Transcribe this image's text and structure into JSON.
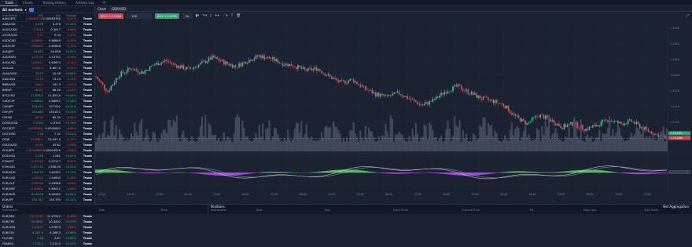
{
  "tabs": [
    "Trade",
    "Charts",
    "Trading History",
    "Activity Log"
  ],
  "tab_plus": "+",
  "watchlist": {
    "selector": "All markets",
    "columns": [
      "Instrument",
      "Bid",
      "Ask",
      "Change",
      ""
    ],
    "rows": [
      {
        "sym": "AAVE/BTC",
        "bid": "0.00083730",
        "ask": "0.00083760",
        "chg": "-0.37%",
        "dir": "dn"
      },
      {
        "sym": "ADA/USD",
        "bid": "0.476",
        "ask": "0.476",
        "chg": "+1.25%",
        "dir": "up"
      },
      {
        "sym": "ALGO/USD",
        "bid": "0.3016",
        "ask": "0.3017",
        "chg": "-0.96%",
        "dir": "dn"
      },
      {
        "sym": "ATOM/USD",
        "bid": "9.31",
        "ask": "9.33",
        "chg": "-1.57%",
        "dir": "dn"
      },
      {
        "sym": "AUD/CAD",
        "bid": "0.88645",
        "ask": "0.88649",
        "chg": "-0.29%",
        "dir": "dn"
      },
      {
        "sym": "AUD/CHF",
        "bid": "0.60852",
        "ask": "0.60858",
        "chg": "-0.12%",
        "dir": "dn"
      },
      {
        "sym": "AUD/JPY",
        "bid": "94.852",
        "ask": "94.858",
        "chg": "+0.02%",
        "dir": "up"
      },
      {
        "sym": "AUD/NZD",
        "bid": "1.10746",
        "ask": "1.10751",
        "chg": "-0.08%",
        "dir": "dn"
      },
      {
        "sym": "AUD/USD",
        "bid": "0.65671",
        "ask": "0.65674",
        "chg": "-0.11%",
        "dir": "dn"
      },
      {
        "sym": "AUS200",
        "bid": "6,855.0",
        "ask": "6,857.0",
        "chg": "-0.31%",
        "dir": "dn"
      },
      {
        "sym": "AVAX/USD",
        "bid": "20.37",
        "ask": "20.38",
        "chg": "+0.64%",
        "dir": "up"
      },
      {
        "sym": "AXS/USD",
        "bid": "13.12",
        "ask": "13.14",
        "chg": "-2.11%",
        "dir": "dn"
      },
      {
        "sym": "BNB/USD",
        "bid": "240.3",
        "ask": "241.3",
        "chg": "-0.37%",
        "dir": "dn"
      },
      {
        "sym": "BRENT",
        "bid": "86.47",
        "ask": "86.50",
        "chg": "-0.21%",
        "dir": "dn"
      },
      {
        "sym": "BTC/USD",
        "bid": "21,828.0",
        "ask": "21,853.0",
        "chg": "+0.44%",
        "dir": "up"
      },
      {
        "sym": "CAD/CHF",
        "bid": "0.68642",
        "ask": "0.68651",
        "chg": "+0.18%",
        "dir": "up"
      },
      {
        "sym": "CAD/JPY",
        "bid": "106.991",
        "ask": "107.001",
        "chg": "+0.31%",
        "dir": "up"
      },
      {
        "sym": "CHF/JPY",
        "bid": "155.863",
        "ask": "155.871",
        "chg": "+0.15%",
        "dir": "up"
      },
      {
        "sym": "CRUDE",
        "bid": "80.32",
        "ask": "80.35",
        "chg": "-0.48%",
        "dir": "dn"
      },
      {
        "sym": "DOGE/USD",
        "bid": "0.0794",
        "ask": "0.0795",
        "chg": "+0.78%",
        "dir": "up"
      },
      {
        "sym": "DOT/BTC",
        "bid": "0.0002682",
        "ask": "0.0002697",
        "chg": "-0.68%",
        "dir": "dn"
      },
      {
        "sym": "DOT/USD",
        "bid": "7.28",
        "ask": "7.31",
        "chg": "+0.21%",
        "dir": "up"
      },
      {
        "sym": "DOW",
        "bid": "33,988.0",
        "ask": "33,991.0",
        "chg": "-0.12%",
        "dir": "dn"
      },
      {
        "sym": "EGLD/USD",
        "bid": "45.48",
        "ask": "45.62",
        "chg": "-1.43%",
        "dir": "dn"
      },
      {
        "sym": "EOS/BTC",
        "bid": "0.00004880",
        "ask": "0.00004910",
        "chg": "-0.99%",
        "dir": "dn"
      },
      {
        "sym": "EOS/USD",
        "bid": "1.056",
        "ask": "1.061",
        "chg": "+0.47%",
        "dir": "up"
      },
      {
        "sym": "ETH/BTC",
        "bid": "0.07124",
        "ask": "0.07127",
        "chg": "-0.22%",
        "dir": "dn"
      },
      {
        "sym": "ETH/USD",
        "bid": "1,557.42",
        "ask": "1,558.09",
        "chg": "+0.21%",
        "dir": "up"
      },
      {
        "sym": "EUR/AUD",
        "bid": "1.64275",
        "ask": "1.64287",
        "chg": "+0.13%",
        "dir": "up"
      },
      {
        "sym": "EUR/CAD",
        "bid": "1.45624",
        "ask": "1.45635",
        "chg": "-0.16%",
        "dir": "dn"
      },
      {
        "sym": "EUR/CHF",
        "bid": "0.99958",
        "ask": "0.99966",
        "chg": "-0.03%",
        "dir": "dn"
      },
      {
        "sym": "EUR/GBP",
        "bid": "0.89005",
        "ask": "0.89011",
        "chg": "-0.08%",
        "dir": "dn"
      },
      {
        "sym": "EUR/HKD",
        "bid": "8.45208",
        "ask": "8.45289",
        "chg": "+0.02%",
        "dir": "up"
      },
      {
        "sym": "EUR/JPY",
        "bid": "155.787",
        "ask": "155.795",
        "chg": "+0.12%",
        "dir": "up"
      },
      {
        "sym": "EUR/MXN",
        "bid": "20.77717",
        "ask": "20.79351",
        "chg": "+0.31%",
        "dir": "up"
      },
      {
        "sym": "EUR/NZD",
        "bid": "1.81922",
        "ask": "1.81951",
        "chg": "+0.05%",
        "dir": "up"
      },
      {
        "sym": "EUR/SEK",
        "bid": "11.27431",
        "ask": "11.27911",
        "chg": "-0.18%",
        "dir": "dn"
      },
      {
        "sym": "EUR/TRY",
        "bid": "20.3051",
        "ask": "20.3401",
        "chg": "+0.07%",
        "dir": "up"
      },
      {
        "sym": "EUR/USD",
        "bid": "1.07875",
        "ask": "1.07879",
        "chg": "-0.04%",
        "dir": "dn"
      },
      {
        "sym": "EURO50",
        "bid": "4,267.0",
        "ask": "4,268.5",
        "chg": "+0.46%",
        "dir": "up"
      },
      {
        "sym": "FIL/USD",
        "bid": "5.66",
        "ask": "5.67",
        "chg": "+1.85%",
        "dir": "up"
      },
      {
        "sym": "FRANCE",
        "bid": "7,213.5",
        "ask": "7,214.5",
        "chg": "+0.37%",
        "dir": "up"
      }
    ],
    "trade_label": "Trade"
  },
  "chart": {
    "window_label": "Chart",
    "instrument": "GBP/USD",
    "sell_label": "SELL",
    "sell_price": "1.21248",
    "buy_label": "BUY",
    "buy_price": "1.21259",
    "quantity": "100",
    "timeframe": "1h",
    "price_ticks": [
      "1.2400",
      "1.2350",
      "1.2300",
      "1.2250",
      "1.2200",
      "1.2150",
      "1.2100",
      "1.2050"
    ],
    "price_tag_buy": "1.21259",
    "price_tag_sell": "1.21248",
    "time_ticks": [
      "07:00",
      "14:00",
      "21:00",
      "04:00",
      "11:00",
      "18:00",
      "01:00",
      "08:00",
      "15:00",
      "22:00",
      "05:00",
      "12:00",
      "19:00",
      "02:00",
      "09:00",
      "16:00",
      "23:00",
      "06:00",
      "13:00",
      "20:00"
    ]
  },
  "chart_data": {
    "type": "candlestick",
    "series": [
      {
        "values": [
          1.2268,
          1.2232,
          1.2275,
          1.229,
          1.228,
          1.23,
          1.231,
          1.2296,
          1.2288,
          1.2302,
          1.2318,
          1.2305,
          1.2295,
          1.231,
          1.2322,
          1.2315,
          1.2303,
          1.2297,
          1.2285,
          1.229,
          1.227,
          1.2254,
          1.2262,
          1.224,
          1.2225,
          1.2218,
          1.2228,
          1.2212,
          1.2196,
          1.221,
          1.2232,
          1.2245,
          1.223,
          1.2215,
          1.2208,
          1.2198,
          1.2168,
          1.215,
          1.2172,
          1.216,
          1.2142,
          1.215,
          1.2136,
          1.2146,
          1.216,
          1.215,
          1.2156,
          1.2138,
          1.2124,
          1.2113
        ]
      }
    ],
    "ylim": [
      1.208,
      1.241
    ],
    "indicator": "MACD"
  },
  "bottom": {
    "orders_title": "Orders",
    "orders_cols": [
      "Instrument",
      "Side",
      "Price"
    ],
    "positions_title": "Positions",
    "positions_cols": [
      "Instrument",
      "Side",
      "Size",
      "Entry Price",
      "Current Price",
      "P/L",
      "Stop Loss",
      "Take Profit"
    ],
    "net_aggregation": "Net Aggregation"
  },
  "colors": {
    "up": "#3ec28f",
    "down": "#e05562",
    "accent": "#4aa3ff"
  }
}
